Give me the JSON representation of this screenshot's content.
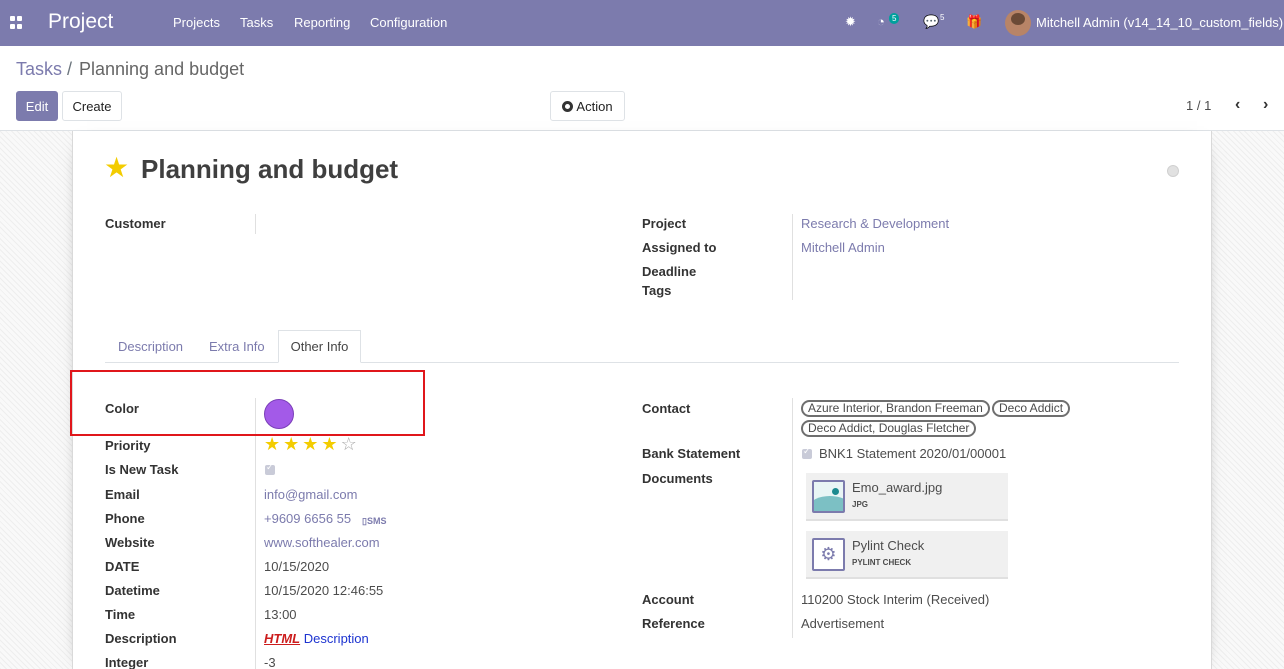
{
  "navbar": {
    "brand": "Project",
    "menu": [
      "Projects",
      "Tasks",
      "Reporting",
      "Configuration"
    ],
    "activity_count": "5",
    "message_count": "5",
    "user": "Mitchell Admin (v14_14_10_custom_fields)"
  },
  "breadcrumb": {
    "parent": "Tasks",
    "separator": "/",
    "current": "Planning and budget"
  },
  "toolbar": {
    "edit": "Edit",
    "create": "Create",
    "action": "Action",
    "pager": "1 / 1"
  },
  "task": {
    "title": "Planning and budget",
    "customer_label": "Customer",
    "project_label": "Project",
    "project_value": "Research & Development",
    "assigned_label": "Assigned to",
    "assigned_value": "Mitchell Admin",
    "deadline_label": "Deadline",
    "tags_label": "Tags"
  },
  "tabs": [
    "Description",
    "Extra Info",
    "Other Info"
  ],
  "other_info": {
    "left": [
      {
        "label": "Color"
      },
      {
        "label": "Priority",
        "rating": 4,
        "max": 5
      },
      {
        "label": "Is New Task",
        "checked": true
      },
      {
        "label": "Email",
        "value": "info@gmail.com"
      },
      {
        "label": "Phone",
        "value": "+9609 6656 55",
        "sms": "SMS"
      },
      {
        "label": "Website",
        "value": "www.softhealer.com"
      },
      {
        "label": "DATE",
        "value": "10/15/2020"
      },
      {
        "label": "Datetime",
        "value": "10/15/2020 12:46:55"
      },
      {
        "label": "Time",
        "value": "13:00"
      },
      {
        "label": "Description",
        "html": "HTML",
        "text": "Description"
      },
      {
        "label": "Integer",
        "value": "-3"
      }
    ],
    "color_value": "#a35ae8",
    "contact_label": "Contact",
    "contact_tags": [
      "Azure Interior, Brandon Freeman",
      "Deco Addict",
      "Deco Addict, Douglas Fletcher"
    ],
    "bank_label": "Bank Statement",
    "bank_value": "BNK1 Statement 2020/01/00001",
    "documents_label": "Documents",
    "documents": [
      {
        "name": "Emo_award.jpg",
        "ext": "JPG",
        "icon": "image-icon"
      },
      {
        "name": "Pylint Check",
        "ext": "PYLINT CHECK",
        "icon": "gear-icon"
      }
    ],
    "account_label": "Account",
    "account_value": "110200 Stock Interim (Received)",
    "reference_label": "Reference",
    "reference_value": "Advertisement"
  },
  "colors": {
    "navbar": "#7c7bad",
    "star": "#f3cc00",
    "highlight": "#e0161b"
  }
}
